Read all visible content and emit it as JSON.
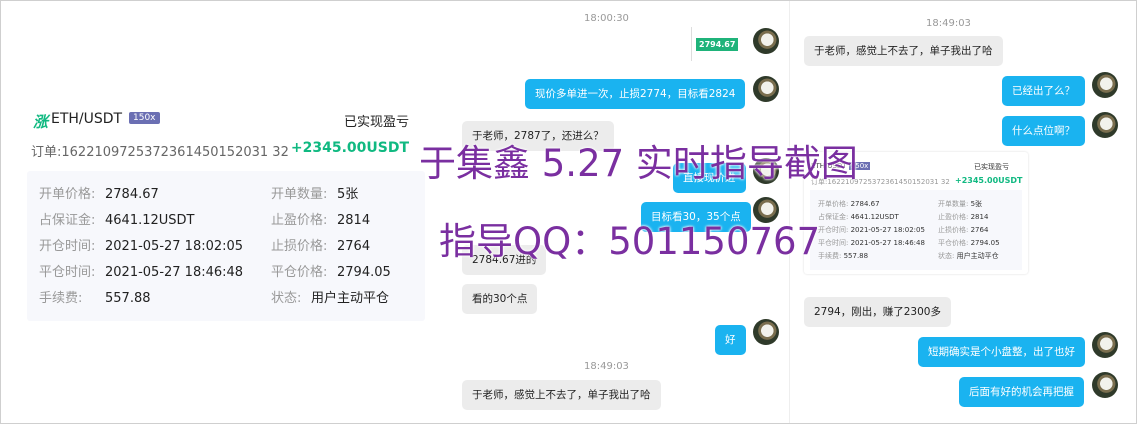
{
  "chat_left": {
    "time1": "18:00:30",
    "snip_price": "2794.67",
    "msg_out_1": "现价多单进一次，止损2774，目标看2824",
    "msg_in_1": "于老师，2787了，还进么？",
    "msg_out_2": "直接现价进",
    "msg_out_3": "目标看30，35个点",
    "msg_in_2": "2784.67进的",
    "msg_in_3": "看的30个点",
    "msg_out_4": "好",
    "time2": "18:49:03",
    "msg_in_4": "于老师，感觉上不去了，单子我出了哈"
  },
  "chat_right": {
    "time1": "18:49:03",
    "msg_in_1": "于老师，感觉上不去了，单子我出了哈",
    "msg_out_1": "已经出了么？",
    "msg_out_2": "什么点位啊？",
    "msg_in_2": "2794，刚出，赚了2300多",
    "msg_out_3": "短期确实是个小盘整，出了也好",
    "msg_out_4": "后面有好的机会再把握"
  },
  "order_card": {
    "logo": "涨",
    "pair": "ETH/USDT",
    "leverage": "150x",
    "pnl_label": "已实现盈亏",
    "order_label": "订单:",
    "order_id": "1622109725372361450152031 32",
    "pnl_value": "+2345.00USDT",
    "fields": {
      "open_price_k": "开单价格:",
      "open_price_v": "2784.67",
      "open_qty_k": "开单数量:",
      "open_qty_v": "5张",
      "margin_k": "占保证金:",
      "margin_v": "4641.12USDT",
      "tp_k": "止盈价格:",
      "tp_v": "2814",
      "open_time_k": "开仓时间:",
      "open_time_v": "2021-05-27 18:02:05",
      "sl_k": "止损价格:",
      "sl_v": "2764",
      "close_time_k": "平仓时间:",
      "close_time_v": "2021-05-27 18:46:48",
      "close_price_k": "平仓价格:",
      "close_price_v": "2794.05",
      "fee_k": "手续费:",
      "fee_v": "557.88",
      "status_k": "状态:",
      "status_v": "用户主动平仓"
    }
  },
  "mini_card": {
    "pair": "ETH/USDT",
    "leverage": "150x",
    "pnl_label": "已实现盈亏",
    "order": "订单:1622109725372361450152031 32",
    "pnl_value": "+2345.00USDT"
  },
  "watermark": {
    "line1": "于集鑫 5.27 实时指导截图",
    "line2": "指导QQ：501150767"
  }
}
